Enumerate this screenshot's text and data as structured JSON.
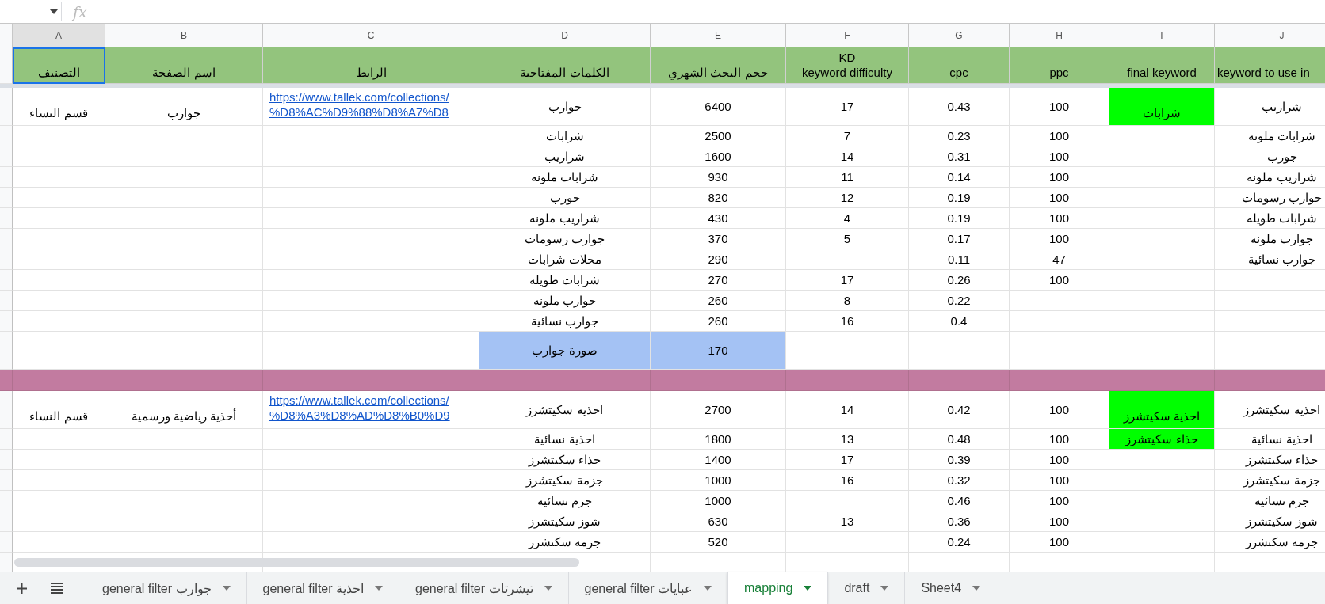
{
  "formula_bar": {
    "label": "fx"
  },
  "columns": [
    {
      "letter": "J",
      "header": "keyword to use in",
      "selected": false
    },
    {
      "letter": "I",
      "header": "final keyword",
      "selected": false
    },
    {
      "letter": "H",
      "header": "ppc",
      "selected": false
    },
    {
      "letter": "G",
      "header": "cpc",
      "selected": false
    },
    {
      "letter": "F",
      "header": "KD\nkeyword difficulty",
      "selected": false
    },
    {
      "letter": "E",
      "header": "حجم البحث الشهري",
      "selected": false
    },
    {
      "letter": "D",
      "header": "الكلمات المفتاحية",
      "selected": false
    },
    {
      "letter": "C",
      "header": "الرابط",
      "selected": false
    },
    {
      "letter": "B",
      "header": "اسم الصفحة",
      "selected": false
    },
    {
      "letter": "A",
      "header": "التصنيف",
      "selected": true
    }
  ],
  "rows": [
    {
      "kind": "tall",
      "cells": [
        "شراريب",
        {
          "text": "شرابات",
          "color": "#00ff00"
        },
        "100",
        "0.43",
        "17",
        "6400",
        "جوارب",
        {
          "link": "https://www.tallek.com/collections/\n%D8%AC%D9%88%D8%A7%D8"
        },
        "جوارب",
        "قسم النساء"
      ]
    },
    {
      "kind": "normal",
      "cells": [
        "شرابات ملونه",
        null,
        "100",
        "0.23",
        "7",
        "2500",
        "شرابات",
        null,
        null,
        null
      ]
    },
    {
      "kind": "normal",
      "cells": [
        "جورب",
        null,
        "100",
        "0.31",
        "14",
        "1600",
        "شراريب",
        null,
        null,
        null
      ]
    },
    {
      "kind": "normal",
      "cells": [
        "شراريب ملونه",
        null,
        "100",
        "0.14",
        "11",
        "930",
        "شرابات ملونه",
        null,
        null,
        null
      ]
    },
    {
      "kind": "normal",
      "cells": [
        "جوارب رسومات",
        null,
        "100",
        "0.19",
        "12",
        "820",
        "جورب",
        null,
        null,
        null
      ]
    },
    {
      "kind": "normal",
      "cells": [
        "شرابات طويله",
        null,
        "100",
        "0.19",
        "4",
        "430",
        "شراريب ملونه",
        null,
        null,
        null
      ]
    },
    {
      "kind": "normal",
      "cells": [
        "جوارب ملونه",
        null,
        "100",
        "0.17",
        "5",
        "370",
        "جوارب رسومات",
        null,
        null,
        null
      ]
    },
    {
      "kind": "normal",
      "cells": [
        "جوارب نسائية",
        null,
        "47",
        "0.11",
        null,
        "290",
        "محلات شرابات",
        null,
        null,
        null
      ]
    },
    {
      "kind": "normal",
      "cells": [
        null,
        null,
        "100",
        "0.26",
        "17",
        "270",
        "شرابات طويله",
        null,
        null,
        null
      ]
    },
    {
      "kind": "normal",
      "cells": [
        null,
        null,
        null,
        "0.22",
        "8",
        "260",
        "جوارب ملونه",
        null,
        null,
        null
      ]
    },
    {
      "kind": "normal",
      "cells": [
        null,
        null,
        null,
        "0.4",
        "16",
        "260",
        "جوارب نسائية",
        null,
        null,
        null
      ]
    },
    {
      "kind": "tall",
      "cells": [
        null,
        null,
        null,
        null,
        null,
        {
          "text": "170",
          "color": "#a4c2f4"
        },
        {
          "text": "صورة جوارب",
          "color": "#a4c2f4"
        },
        null,
        null,
        null
      ]
    },
    {
      "kind": "band",
      "color": "#c27ba0"
    },
    {
      "kind": "tall",
      "cells": [
        "احذية سكيتشرز",
        {
          "text": "احذية سكيتشرز",
          "color": "#00ff00"
        },
        "100",
        "0.42",
        "14",
        "2700",
        "احذية سكيتشرز",
        {
          "link": "https://www.tallek.com/collections/\n%D8%A3%D8%AD%D8%B0%D9"
        },
        "أحذية رياضية ورسمية",
        "قسم النساء"
      ]
    },
    {
      "kind": "normal",
      "cells": [
        "احذية نسائية",
        {
          "text": "حذاء سكيتشرز",
          "color": "#00ff00"
        },
        "100",
        "0.48",
        "13",
        "1800",
        "احذية نسائية",
        null,
        null,
        null
      ]
    },
    {
      "kind": "normal",
      "cells": [
        "حذاء سكيتشرز",
        null,
        "100",
        "0.39",
        "17",
        "1400",
        "حذاء سكيتشرز",
        null,
        null,
        null
      ]
    },
    {
      "kind": "normal",
      "cells": [
        "جزمة سكيتشرز",
        null,
        "100",
        "0.32",
        "16",
        "1000",
        "جزمة سكيتشرز",
        null,
        null,
        null
      ]
    },
    {
      "kind": "normal",
      "cells": [
        "جزم نسائيه",
        null,
        "100",
        "0.46",
        null,
        "1000",
        "جزم نسائيه",
        null,
        null,
        null
      ]
    },
    {
      "kind": "normal",
      "cells": [
        "شوز سكيتشرز",
        null,
        "100",
        "0.36",
        "13",
        "630",
        "شوز سكيتشرز",
        null,
        null,
        null
      ]
    },
    {
      "kind": "normal",
      "cells": [
        "جزمه سكتشرز",
        null,
        "100",
        "0.24",
        null,
        "520",
        "جزمه سكتشرز",
        null,
        null,
        null
      ]
    }
  ],
  "sheet_tabs": [
    {
      "label": "Sheet4",
      "selected": false
    },
    {
      "label": "draft",
      "selected": false
    },
    {
      "label": "mapping",
      "selected": true
    },
    {
      "label": "general filter عبايات",
      "selected": false
    },
    {
      "label": "general filter تيشرتات",
      "selected": false
    },
    {
      "label": "general filter احذية",
      "selected": false
    },
    {
      "label": "general filter جوارب",
      "selected": false
    }
  ]
}
